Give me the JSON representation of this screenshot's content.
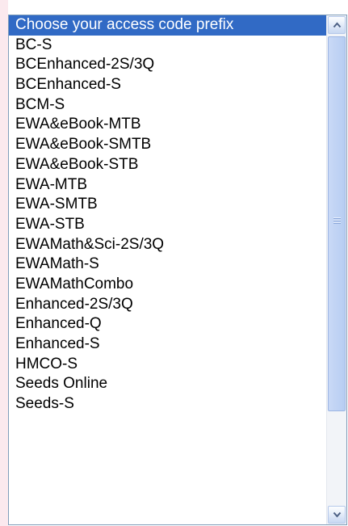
{
  "dropdown": {
    "selected_index": 0,
    "items": [
      "Choose your access code prefix",
      "BC-S",
      "BCEnhanced-2S/3Q",
      "BCEnhanced-S",
      "BCM-S",
      "EWA&eBook-MTB",
      "EWA&eBook-SMTB",
      "EWA&eBook-STB",
      "EWA-MTB",
      "EWA-SMTB",
      "EWA-STB",
      "EWAMath&Sci-2S/3Q",
      "EWAMath-S",
      "EWAMathCombo",
      "Enhanced-2S/3Q",
      "Enhanced-Q",
      "Enhanced-S",
      "HMCO-S",
      "Seeds Online",
      "Seeds-S"
    ]
  },
  "scrollbar": {
    "up_icon": "chevron-up-icon",
    "down_icon": "chevron-down-icon",
    "thumb_grip_icon": "grip-icon"
  },
  "colors": {
    "selection": "#316ac5",
    "scroll_button": "#c8d8f2",
    "backdrop": "#fbe9ee"
  }
}
